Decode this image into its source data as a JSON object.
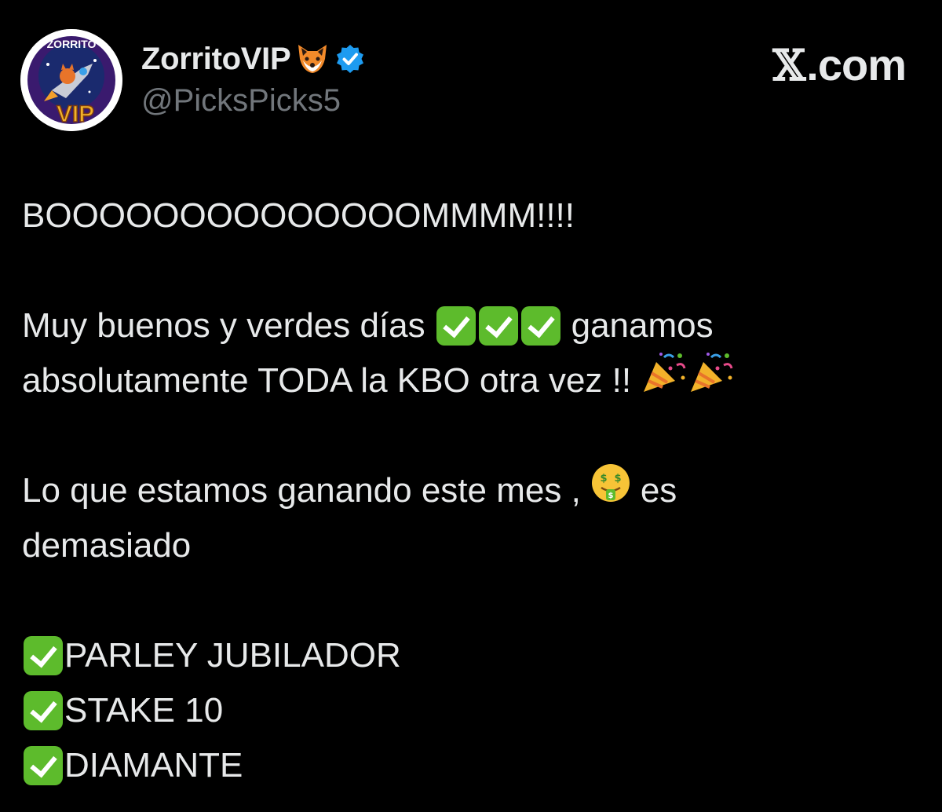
{
  "author": {
    "display_name": "ZorritoVIP",
    "handle": "@PicksPicks5",
    "avatar": {
      "top_text": "ZORRITO",
      "bottom_text": "VIP"
    },
    "name_emoji": "fox-face-icon",
    "verified": true,
    "verified_color": "#1d9bf0"
  },
  "brand": {
    "x_glyph": "𝕏",
    "suffix": ".com"
  },
  "tweet": {
    "line1": "BOOOOOOOOOOOOOOMMMM!!!!",
    "line2_a": "Muy buenos y verdes días",
    "line2_b": "ganamos",
    "line3": "absolutamente TODA la KBO otra vez !!",
    "line4_a": "Lo que estamos ganando este mes ,",
    "line4_b": "es",
    "line5": "demasiado",
    "list": [
      "PARLEY JUBILADOR",
      "STAKE 10",
      "DIAMANTE"
    ]
  },
  "colors": {
    "background": "#000000",
    "text": "#e7e9ea",
    "secondary_text": "#71767b",
    "check_green": "#5dbb2c"
  }
}
